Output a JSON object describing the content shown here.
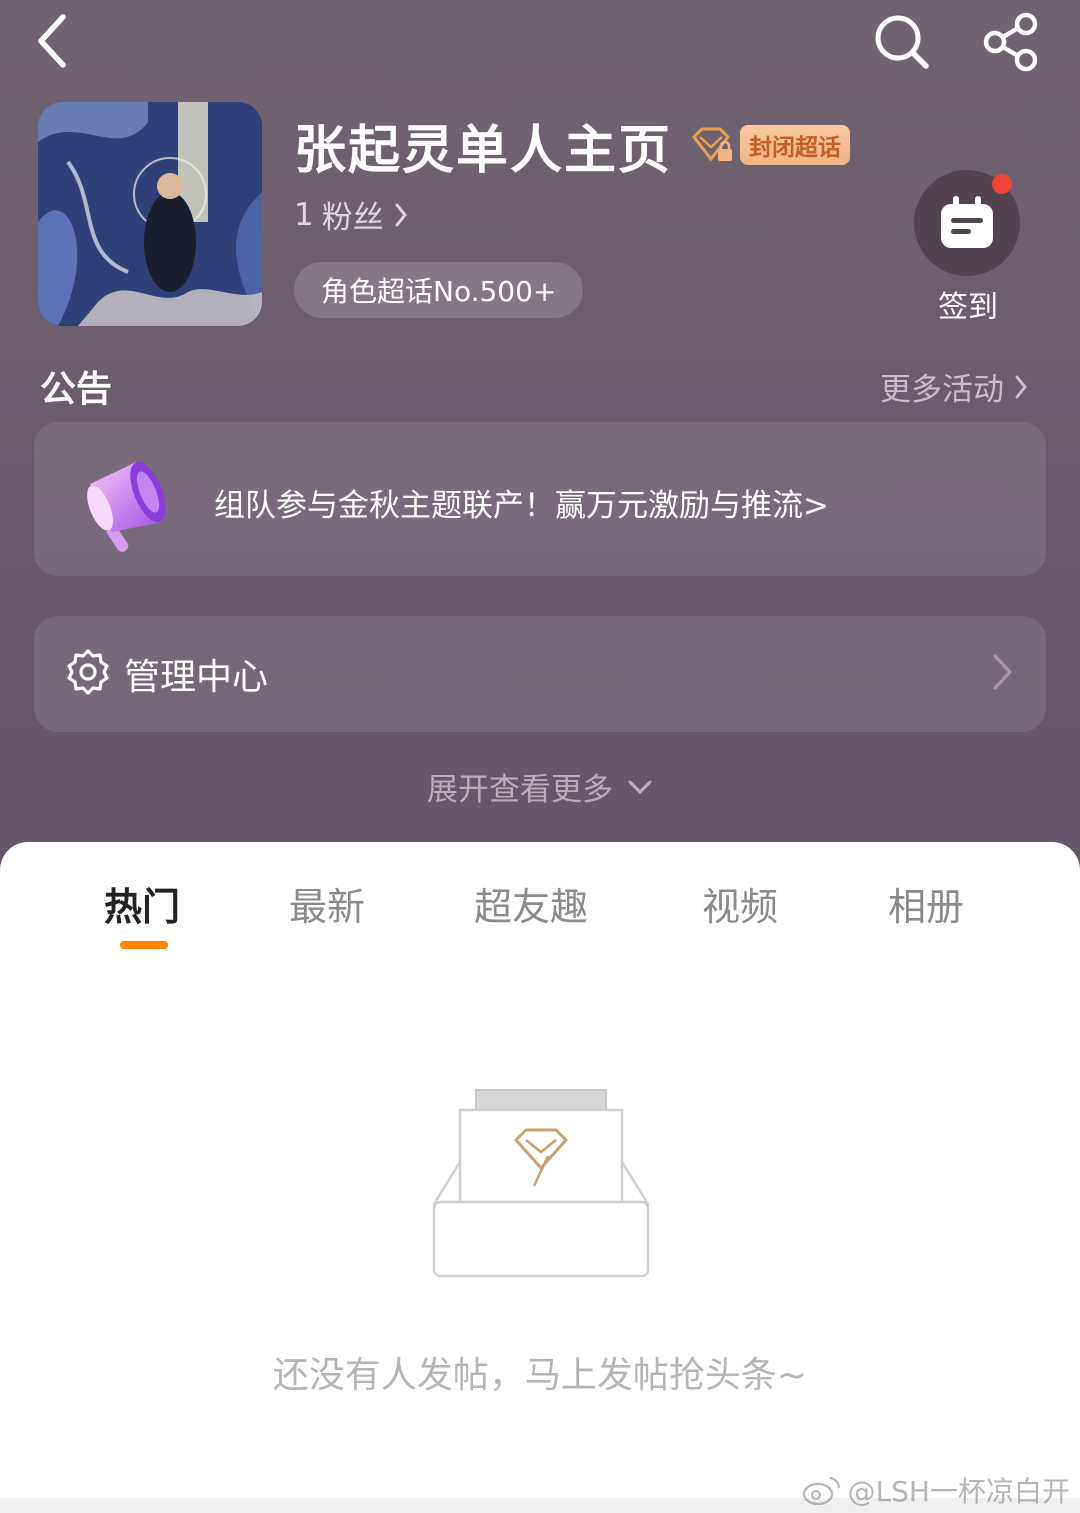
{
  "header": {
    "back_icon": "chevron-left-icon",
    "search_icon": "search-icon",
    "share_icon": "share-icon"
  },
  "profile": {
    "title": "张起灵单人主页",
    "diamond_badge_icon": "diamond-lock-icon",
    "closed_badge": "封闭超话",
    "fans_count": "1",
    "fans_label": "粉丝",
    "rank": "角色超话No.500+",
    "checkin_label": "签到",
    "checkin_icon": "calendar-icon"
  },
  "notice": {
    "heading": "公告",
    "more_label": "更多活动",
    "message": "组队参与金秋主题联产！赢万元激励与推流>",
    "icon": "megaphone-icon"
  },
  "manage": {
    "label": "管理中心",
    "icon": "gear-icon"
  },
  "expand_label": "展开查看更多",
  "tabs": [
    {
      "label": "热门",
      "active": true
    },
    {
      "label": "最新",
      "active": false
    },
    {
      "label": "超友趣",
      "active": false
    },
    {
      "label": "视频",
      "active": false
    },
    {
      "label": "相册",
      "active": false
    }
  ],
  "empty": {
    "message": "还没有人发帖，马上发帖抢头条~",
    "icon": "empty-box-icon"
  },
  "watermark": "@LSH一杯凉白开",
  "colors": {
    "accent": "#ff8200",
    "badge_bg": "#f3bb8f",
    "badge_text": "#c65d22",
    "notification_dot": "#f0433a"
  }
}
